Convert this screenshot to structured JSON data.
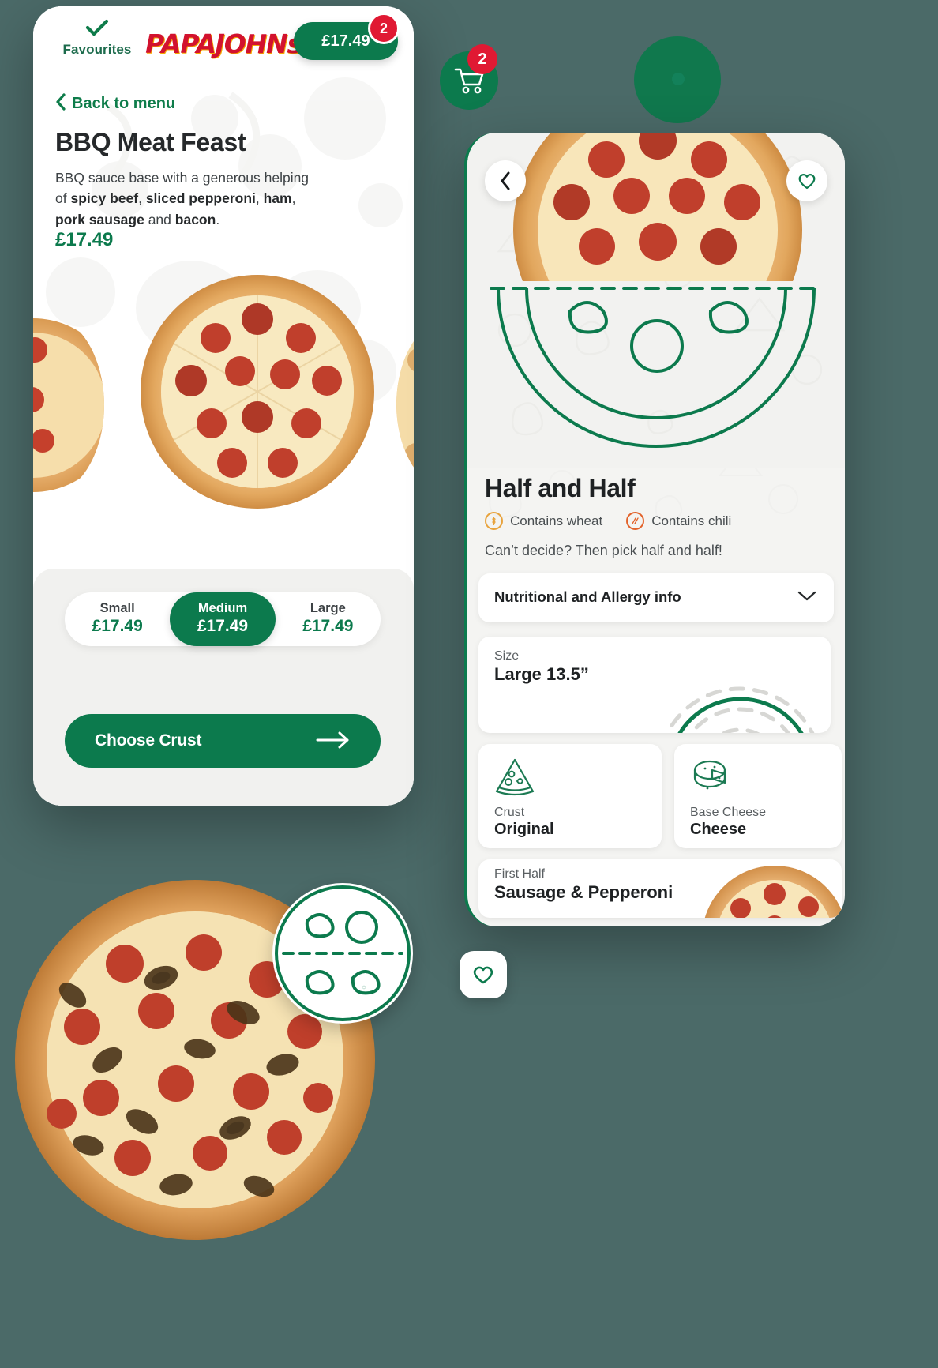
{
  "brand": {
    "name": "PAPAJOHNs",
    "accent": "#0c7a4d",
    "red": "#d2122e",
    "badge_red": "#e01933"
  },
  "left_phone": {
    "header": {
      "favourites_label": "Favourites",
      "favourites_icon": "check-icon",
      "logo_text": "PAPAJOHNs",
      "cart_price": "£17.49",
      "cart_badge": "2"
    },
    "back_link": "Back to menu",
    "product": {
      "title": "BBQ Meat Feast",
      "description_prefix": "BBQ sauce base with a generous helping of ",
      "description_parts": [
        "spicy beef",
        ", ",
        "sliced pepperoni",
        ", ",
        "ham",
        ", ",
        "pork sausage",
        " and ",
        "bacon",
        "."
      ],
      "price": "£17.49"
    },
    "sizes": [
      {
        "name": "Small",
        "price": "£17.49",
        "selected": false
      },
      {
        "name": "Medium",
        "price": "£17.49",
        "selected": true
      },
      {
        "name": "Large",
        "price": "£17.49",
        "selected": false
      }
    ],
    "cta": {
      "label": "Choose Crust",
      "icon": "arrow-right-icon"
    }
  },
  "floating": {
    "cart_icon": "shopping-cart-icon",
    "cart_badge": "2",
    "heart_icon": "heart-icon"
  },
  "right_phone": {
    "back_icon": "chevron-left-icon",
    "favourite_icon": "heart-outline-icon",
    "title": "Half and Half",
    "allergens": [
      {
        "label": "Contains wheat",
        "icon": "wheat-allergen-icon",
        "color": "#e8a33d"
      },
      {
        "label": "Contains chili",
        "icon": "chili-allergen-icon",
        "color": "#e2622a"
      }
    ],
    "subtitle": "Can’t decide? Then pick half and half!",
    "accordion": {
      "label": "Nutritional and Allergy info",
      "icon": "chevron-down-icon"
    },
    "options": [
      {
        "key": "Size",
        "value": "Large 13.5”",
        "icon": "size-rings-icon"
      },
      {
        "key": "Crust",
        "value": "Original",
        "icon": "pizza-slice-icon"
      },
      {
        "key": "Base Cheese",
        "value": "Cheese",
        "icon": "cheese-wheel-icon"
      },
      {
        "key": "First Half",
        "value": "Sausage & Pepperoni",
        "icon": "pizza-half-icon"
      }
    ]
  }
}
